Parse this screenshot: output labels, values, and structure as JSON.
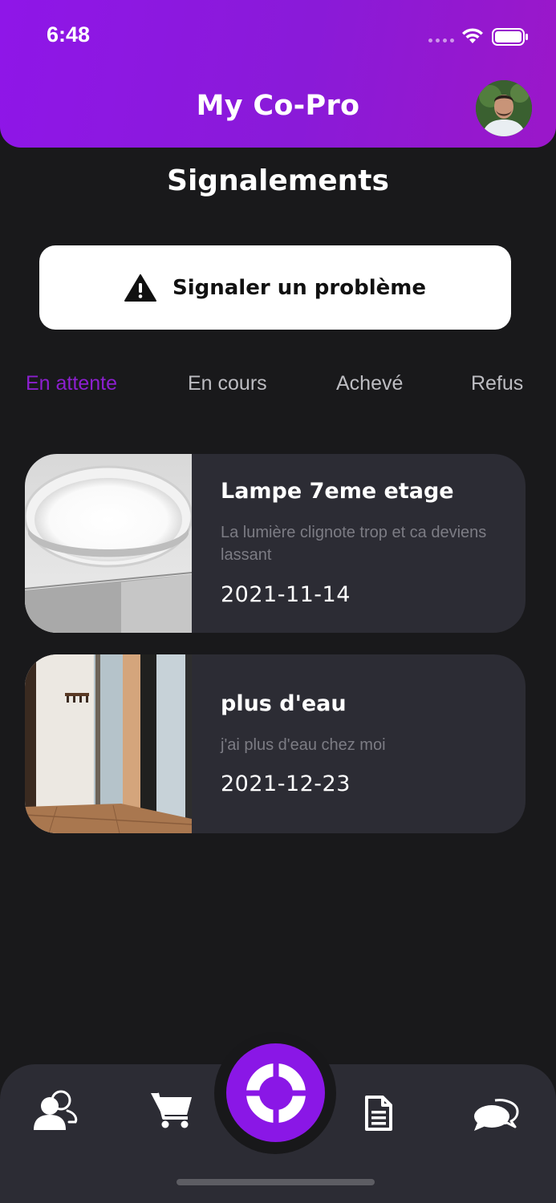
{
  "status_bar": {
    "time": "6:48",
    "icons": [
      "signal-dots-icon",
      "wifi-icon",
      "battery-icon"
    ]
  },
  "header": {
    "title": "My Co-Pro",
    "avatar": "avatar-photo"
  },
  "page": {
    "title": "Signalements"
  },
  "report_button": {
    "label": "Signaler un problème",
    "icon": "warning-icon"
  },
  "tabs": [
    {
      "label": "En attente",
      "active": true
    },
    {
      "label": "En cours",
      "active": false
    },
    {
      "label": "Achevé",
      "active": false
    },
    {
      "label": "Refus",
      "active": false
    }
  ],
  "reports": [
    {
      "title": "Lampe 7eme etage",
      "description": "La lumière clignote trop et ca deviens lassant",
      "date": "2021-11-14",
      "image": "ceiling-lamp-photo"
    },
    {
      "title": "plus d'eau",
      "description": "j'ai plus d'eau chez moi",
      "date": "2021-12-23",
      "image": "room-interior-photo"
    }
  ],
  "bottom_nav": {
    "items": [
      "people-icon",
      "cart-icon",
      "lifebuoy-icon",
      "document-icon",
      "chat-icon"
    ]
  },
  "colors": {
    "accent": "#8a17e6",
    "active_tab": "#8c1fcf",
    "background": "#19191b",
    "card": "#2c2c34"
  }
}
